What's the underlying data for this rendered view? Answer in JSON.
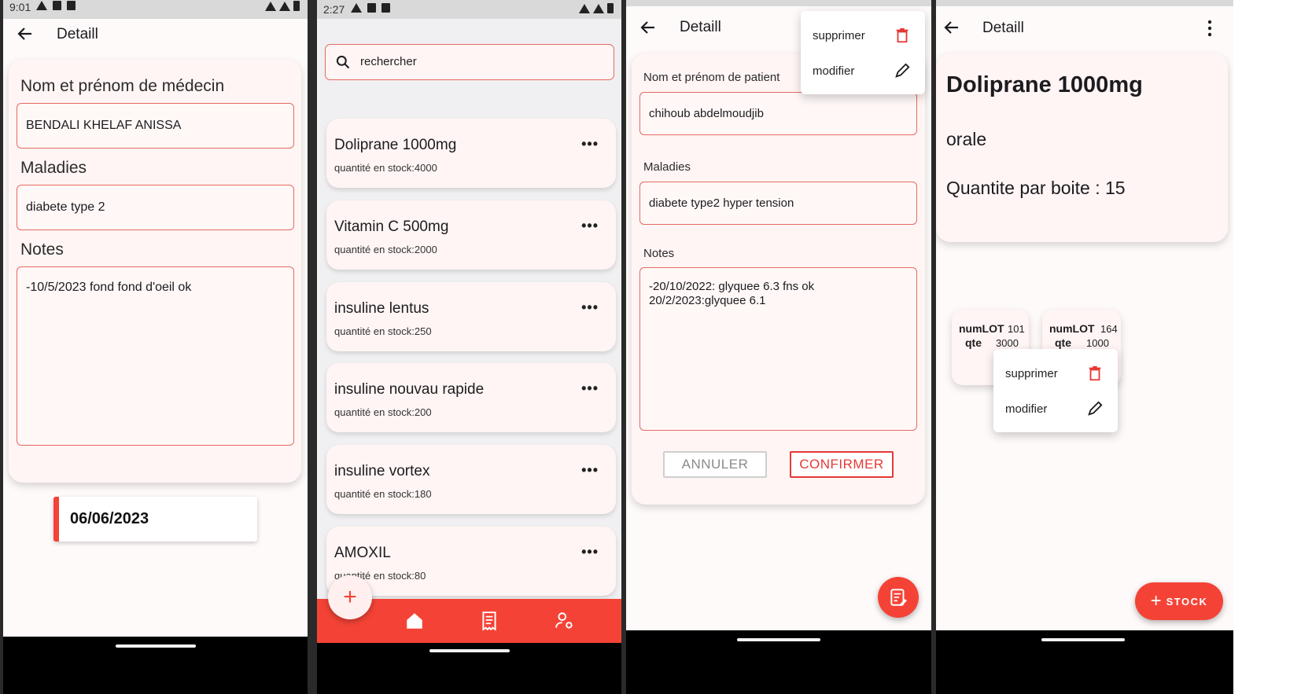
{
  "screen1": {
    "status_time": "9:01",
    "title": "Detaill",
    "doctor_label": "Nom et prénom de médecin",
    "doctor_value": "BENDALI  KHELAF ANISSA",
    "diseases_label": "Maladies",
    "diseases_value": "diabete type 2",
    "notes_label": "Notes",
    "notes_value": "-10/5/2023 fond fond d'oeil ok",
    "date": "06/06/2023"
  },
  "screen2": {
    "status_time": "2:27",
    "search_placeholder": "rechercher",
    "items": [
      {
        "name": "Doliprane 1000mg",
        "stock": "quantité en stock:4000"
      },
      {
        "name": "Vitamin C 500mg",
        "stock": "quantité en stock:2000"
      },
      {
        "name": "insuline lentus",
        "stock": "quantité en stock:250"
      },
      {
        "name": "insuline nouvau rapide",
        "stock": "quantité en stock:200"
      },
      {
        "name": "insuline vortex",
        "stock": "quantité en stock:180"
      },
      {
        "name": "AMOXIL",
        "stock": "quantité en stock:80"
      }
    ],
    "more_label": "•••",
    "fab_label": "+",
    "nav_icons": [
      "home-icon",
      "receipt-icon",
      "user-settings-icon"
    ]
  },
  "screen3": {
    "title": "Detaill",
    "menu": {
      "delete_label": "supprimer",
      "edit_label": "modifier"
    },
    "patient_label": "Nom et prénom de patient",
    "patient_value": "chihoub  abdelmoudjib",
    "diseases_label": "Maladies",
    "diseases_value": "diabete type2 hyper tension",
    "notes_label": "Notes",
    "notes_line1": "-20/10/2022: glyquee 6.3 fns ok",
    "notes_line2": "20/2/2023:glyquee 6.1",
    "cancel_label": "ANNULER",
    "confirm_label": "CONFIRMER"
  },
  "screen4": {
    "title": "Detaill",
    "product_name": "Doliprane 1000mg",
    "route": "orale",
    "per_box": "Quantite par boite : 15",
    "lots": [
      {
        "num_label": "numLOT",
        "num": "101",
        "qte_label": "qte",
        "qte": "3000"
      },
      {
        "num_label": "numLOT",
        "num": "164",
        "qte_label": "qte",
        "qte": "1000"
      }
    ],
    "menu": {
      "delete_label": "supprimer",
      "edit_label": "modifier"
    },
    "fab_label": "STOCK"
  },
  "colors": {
    "accent": "#f44336",
    "card_bg": "#fff5f4",
    "border": "#e46a62"
  }
}
